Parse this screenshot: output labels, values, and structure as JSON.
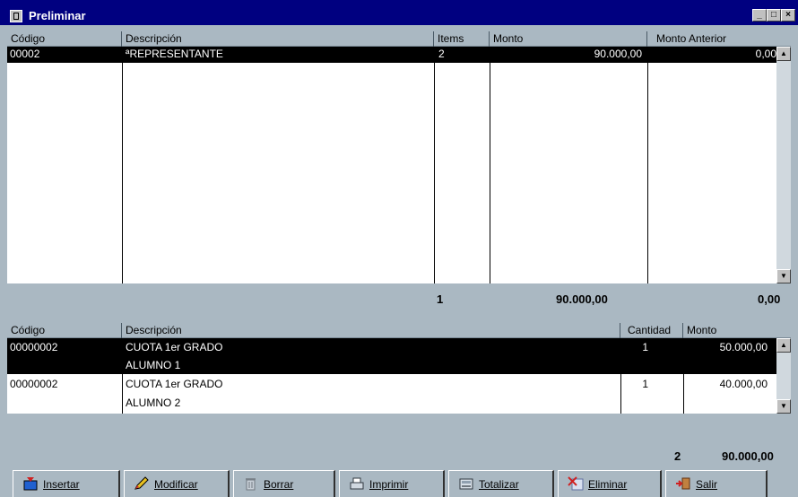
{
  "window": {
    "title": "Preliminar",
    "minimize": "_",
    "maximize": "□",
    "close": "×"
  },
  "top_grid": {
    "columns": [
      "Código",
      "Descripción",
      "Items",
      "Monto",
      "Monto Anterior"
    ],
    "rows": [
      {
        "codigo": "00002",
        "descripcion": "ªREPRESENTANTE",
        "items": "2",
        "monto": "90.000,00",
        "monto_anterior": "0,00",
        "selected": true
      }
    ]
  },
  "top_totals": {
    "items": "1",
    "monto": "90.000,00",
    "monto_anterior": "0,00"
  },
  "bottom_grid": {
    "columns": [
      "Código",
      "Descripción",
      "Cantidad",
      "Monto"
    ],
    "rows": [
      {
        "codigo": "00000002",
        "descripcion_1": "CUOTA 1er GRADO",
        "descripcion_2": "ALUMNO 1",
        "cantidad": "1",
        "monto": "50.000,00",
        "selected": true
      },
      {
        "codigo": "00000002",
        "descripcion_1": "CUOTA 1er GRADO",
        "descripcion_2": "ALUMNO 2",
        "cantidad": "1",
        "monto": "40.000,00",
        "selected": false
      }
    ]
  },
  "bottom_totals": {
    "cantidad": "2",
    "monto": "90.000,00"
  },
  "toolbar": {
    "insertar": "Insertar",
    "modificar": "Modificar",
    "borrar": "Borrar",
    "imprimir": "Imprimir",
    "totalizar": "Totalizar",
    "eliminar": "Eliminar",
    "salir": "Salir"
  },
  "colors": {
    "titlebar": "#000080",
    "background": "#aab8c2",
    "selection": "#000000"
  }
}
